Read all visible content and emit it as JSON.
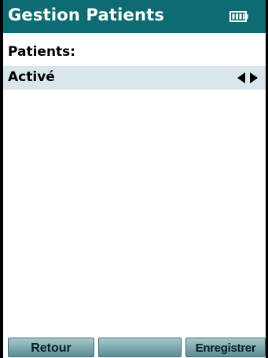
{
  "header": {
    "title": "Gestion Patients",
    "battery_icon": "battery-icon"
  },
  "main": {
    "patients_label": "Patients:",
    "patients_value": "Activé",
    "selector_icon": "left-right-arrows-icon"
  },
  "softkeys": {
    "left_label": "Retour",
    "middle_label": "",
    "right_label": "Enregistrer"
  },
  "colors": {
    "header_bg": "#0d6b73",
    "selection_bg": "#d9e7ec",
    "softkey": "#7ba6ab"
  }
}
